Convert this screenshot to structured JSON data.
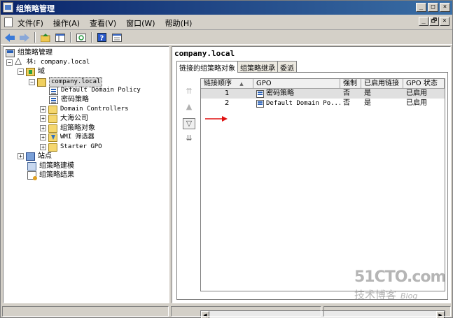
{
  "window": {
    "title": "组策略管理"
  },
  "caption_buttons": [
    "_",
    "□",
    "×"
  ],
  "mdi_buttons": [
    "_",
    "🗗",
    "×"
  ],
  "menu": [
    "文件(F)",
    "操作(A)",
    "查看(V)",
    "窗口(W)",
    "帮助(H)"
  ],
  "toolbar": [
    "back-icon",
    "forward-icon",
    "up-folder-icon",
    "show-hide-tree-icon",
    "refresh-icon",
    "help-icon",
    "properties-icon"
  ],
  "tree": {
    "root": "组策略管理",
    "forest": "林: company.local",
    "domains": "域",
    "domain": "company.local",
    "children": [
      "Default Domain Policy",
      "密码策略",
      "Domain Controllers",
      "大海公司",
      "组策略对象",
      "WMI 筛选器",
      "Starter GPO"
    ],
    "sites": "站点",
    "modeling": "组策略建模",
    "results": "组策略结果"
  },
  "details": {
    "header": "company.local",
    "tabs": [
      "链接的组策略对象",
      "组策略继承",
      "委派"
    ],
    "columns": [
      "链接顺序",
      "GPO",
      "强制",
      "已启用链接",
      "GPO 状态"
    ],
    "sort_indicator": "▲",
    "rows": [
      {
        "order": "1",
        "gpo": "密码策略",
        "enforced": "否",
        "link_enabled": "是",
        "status": "已启用"
      },
      {
        "order": "2",
        "gpo": "Default Domain Po...",
        "enforced": "否",
        "link_enabled": "是",
        "status": "已启用"
      }
    ]
  },
  "watermark": {
    "site": "51CTO.com",
    "sub": "技术博客",
    "blog": "Blog"
  },
  "colors": {
    "titlebar": "#0a246a",
    "arrow": "#e01010",
    "selection": "#e0e0e0"
  }
}
